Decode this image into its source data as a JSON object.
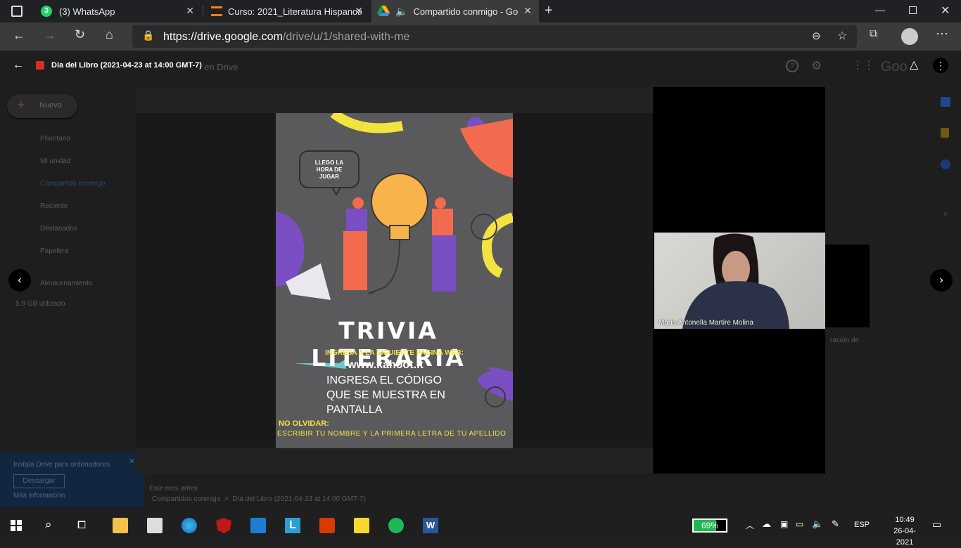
{
  "browser": {
    "tabs": [
      {
        "title": "(3) WhatsApp",
        "active": false
      },
      {
        "title": "Curso: 2021_Literatura Hispanoam",
        "active": false
      },
      {
        "title": "Compartido conmigo - Goo",
        "active": true
      }
    ],
    "url_host": "https://drive.google.com",
    "url_path": "/drive/u/1/shared-with-me"
  },
  "drive": {
    "logo_text": "Drive",
    "search_partial": "en Drive",
    "new_button": "Nuevo",
    "sidebar": [
      {
        "label": "Prioritario"
      },
      {
        "label": "Mi unidad"
      },
      {
        "label": "Compartido conmigo"
      },
      {
        "label": "Reciente"
      },
      {
        "label": "Destacados"
      },
      {
        "label": "Papelera"
      },
      {
        "label": "Almacenamiento"
      }
    ],
    "storage_used": "5.9 GB utilizado",
    "install_title": "Instala Drive para ordenadores",
    "install_button": "Descargar",
    "install_more": "Más información",
    "section_label": "Este mes antes",
    "breadcrumb_root": "Compartidos conmigo",
    "breadcrumb_item": "Día del Libro (2021-04-23 at 14:00 GMT-7)",
    "file_caption_partial": "ración de...",
    "google_partial": "Goo"
  },
  "viewer": {
    "title": "Día del Libro (2021-04-23 at 14:00 GMT-7)",
    "prev_icon": "chevron-left-icon",
    "next_icon": "chevron-right-icon"
  },
  "poster": {
    "bubble": "LLEGO LA HORA DE JUGAR",
    "title": "TRIVIA LITERARIA",
    "instruction": "INGRESA A LA SIGUIENTE PAGINA WEB:",
    "website": "www.kahoot.it",
    "code_text": "INGRESA EL CÓDIGO QUE SE MUESTRA EN PANTALLA",
    "reminder_title": "NO OLVIDAR:",
    "reminder_text": "ESCRIBIR TU NOMBRE Y LA PRIMERA LETRA DE TU APELLIDO",
    "colors": {
      "background": "#5a5a5c",
      "yellow": "#f3e340",
      "orange": "#f26b4f",
      "purple": "#7a4fc4"
    }
  },
  "video": {
    "participant_name": "Maria Antonella Martire Molina"
  },
  "taskbar": {
    "battery_percent": 69,
    "battery_label": "69%",
    "language": "ESP",
    "time": "10:49",
    "date": "26-04-2021"
  }
}
